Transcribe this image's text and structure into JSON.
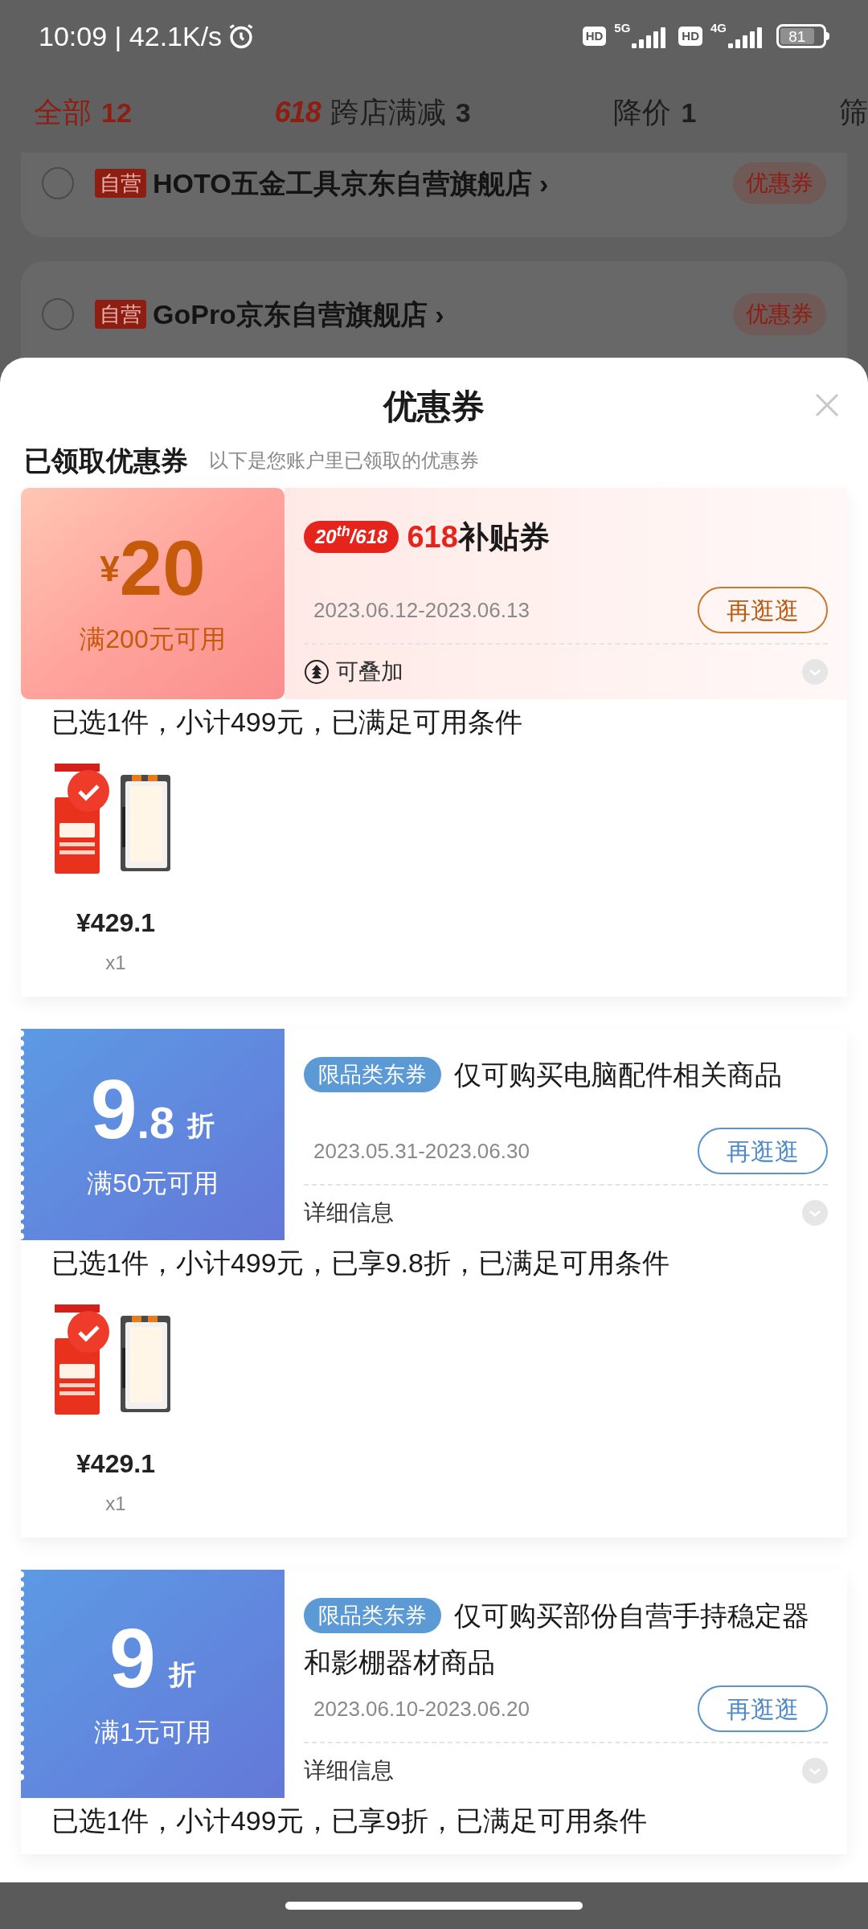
{
  "status_bar": {
    "time": "10:09 | 42.1K/s",
    "networks": [
      {
        "badge": "HD",
        "type": "5G"
      },
      {
        "badge": "HD",
        "type": "4G"
      }
    ],
    "battery": "81"
  },
  "tabs": [
    {
      "kind": "plain",
      "label": "全部",
      "count": "12",
      "selected": true
    },
    {
      "kind": "logo",
      "logo": "618",
      "label": "跨店满减",
      "count": "3",
      "selected": false
    },
    {
      "kind": "plain",
      "label": "降价",
      "count": "1",
      "selected": false
    },
    {
      "kind": "plain",
      "label": "筛",
      "selected": false
    }
  ],
  "stores": [
    {
      "tag": "自营",
      "name": "HOTO五金工具京东自营旗舰店",
      "arrow": "›",
      "coupon_button": "优惠券",
      "checked": false
    },
    {
      "tag": "自营",
      "name": "GoPro京东自营旗舰店",
      "arrow": "›",
      "coupon_button": "优惠券",
      "checked": false
    }
  ],
  "sheet": {
    "title": "优惠券",
    "section": {
      "heading": "已领取优惠券",
      "note": "以下是您账户里已领取的优惠券"
    }
  },
  "coupons": [
    {
      "kind": "amount",
      "currency": "¥",
      "value": "20",
      "condition": "满200元可用",
      "badge": "20$^{th}$/618",
      "title_highlight": "618",
      "title": "补贴券",
      "dates": "2023.06.12-2023.06.13",
      "button": "再逛逛",
      "footer": "可叠加",
      "summary": "已选1件，小计499元，已满足可用条件",
      "items": [
        {
          "price": "¥429.1",
          "qty": "x1",
          "selected": true
        }
      ]
    },
    {
      "kind": "discount",
      "value": "9",
      "decimal": ".8",
      "unit": "折",
      "condition": "满50元可用",
      "badge": "限品类东券",
      "title": "仅可购买电脑配件相关商品",
      "dates": "2023.05.31-2023.06.30",
      "button": "再逛逛",
      "footer": "详细信息",
      "summary": "已选1件，小计499元，已享9.8折，已满足可用条件",
      "items": [
        {
          "price": "¥429.1",
          "qty": "x1",
          "selected": true
        }
      ]
    },
    {
      "kind": "discount",
      "value": "9",
      "unit": "折",
      "condition": "满1元可用",
      "badge": "限品类东券",
      "title": "仅可购买部份自营手持稳定器和影棚器材商品",
      "dates": "2023.06.10-2023.06.20",
      "button": "再逛逛",
      "footer": "详细信息",
      "summary": "已选1件，小计499元，已享9折，已满足可用条件"
    }
  ]
}
